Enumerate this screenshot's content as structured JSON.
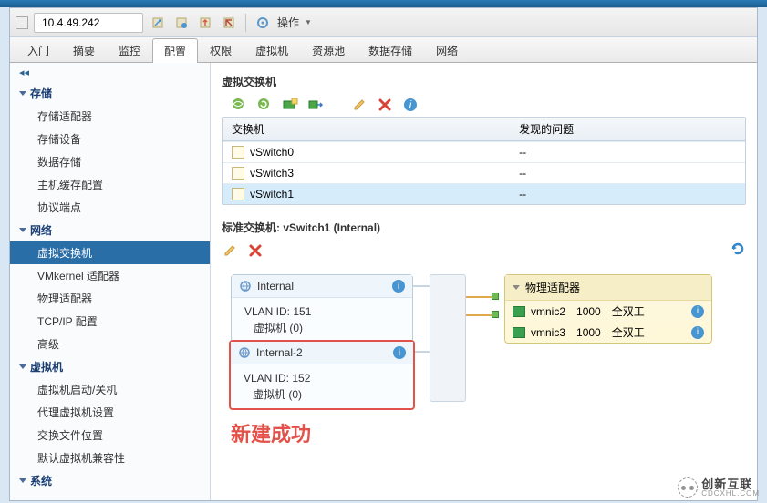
{
  "address": "10.4.49.242",
  "actions_label": "操作",
  "tabs": [
    "入门",
    "摘要",
    "监控",
    "配置",
    "权限",
    "虚拟机",
    "资源池",
    "数据存储",
    "网络"
  ],
  "active_tab": "配置",
  "sidebar": {
    "groups": [
      {
        "title": "存储",
        "items": [
          "存储适配器",
          "存储设备",
          "数据存储",
          "主机缓存配置",
          "协议端点"
        ]
      },
      {
        "title": "网络",
        "items": [
          "虚拟交换机",
          "VMkernel 适配器",
          "物理适配器",
          "TCP/IP 配置",
          "高级"
        ],
        "active_index": 0
      },
      {
        "title": "虚拟机",
        "items": [
          "虚拟机启动/关机",
          "代理虚拟机设置",
          "交换文件位置",
          "默认虚拟机兼容性"
        ]
      },
      {
        "title": "系统",
        "items": []
      }
    ]
  },
  "section_title": "虚拟交换机",
  "table": {
    "headers": [
      "交换机",
      "发现的问题"
    ],
    "rows": [
      {
        "switch": "vSwitch0",
        "problem": "--"
      },
      {
        "switch": "vSwitch3",
        "problem": "--"
      },
      {
        "switch": "vSwitch1",
        "problem": "--",
        "selected": true
      }
    ]
  },
  "detail_header": "标准交换机: vSwitch1 (Internal)",
  "pg1": {
    "name": "Internal",
    "vlan": "VLAN ID: 151",
    "vms": "虚拟机 (0)"
  },
  "pg2": {
    "name": "Internal-2",
    "vlan": "VLAN ID: 152",
    "vms": "虚拟机 (0)"
  },
  "uplink_title": "物理适配器",
  "uplinks": [
    {
      "nic": "vmnic2",
      "speed": "1000",
      "duplex": "全双工"
    },
    {
      "nic": "vmnic3",
      "speed": "1000",
      "duplex": "全双工"
    }
  ],
  "annotation": "新建成功",
  "watermark": {
    "line1": "创新互联",
    "line2": "CDCXHL.COM"
  }
}
